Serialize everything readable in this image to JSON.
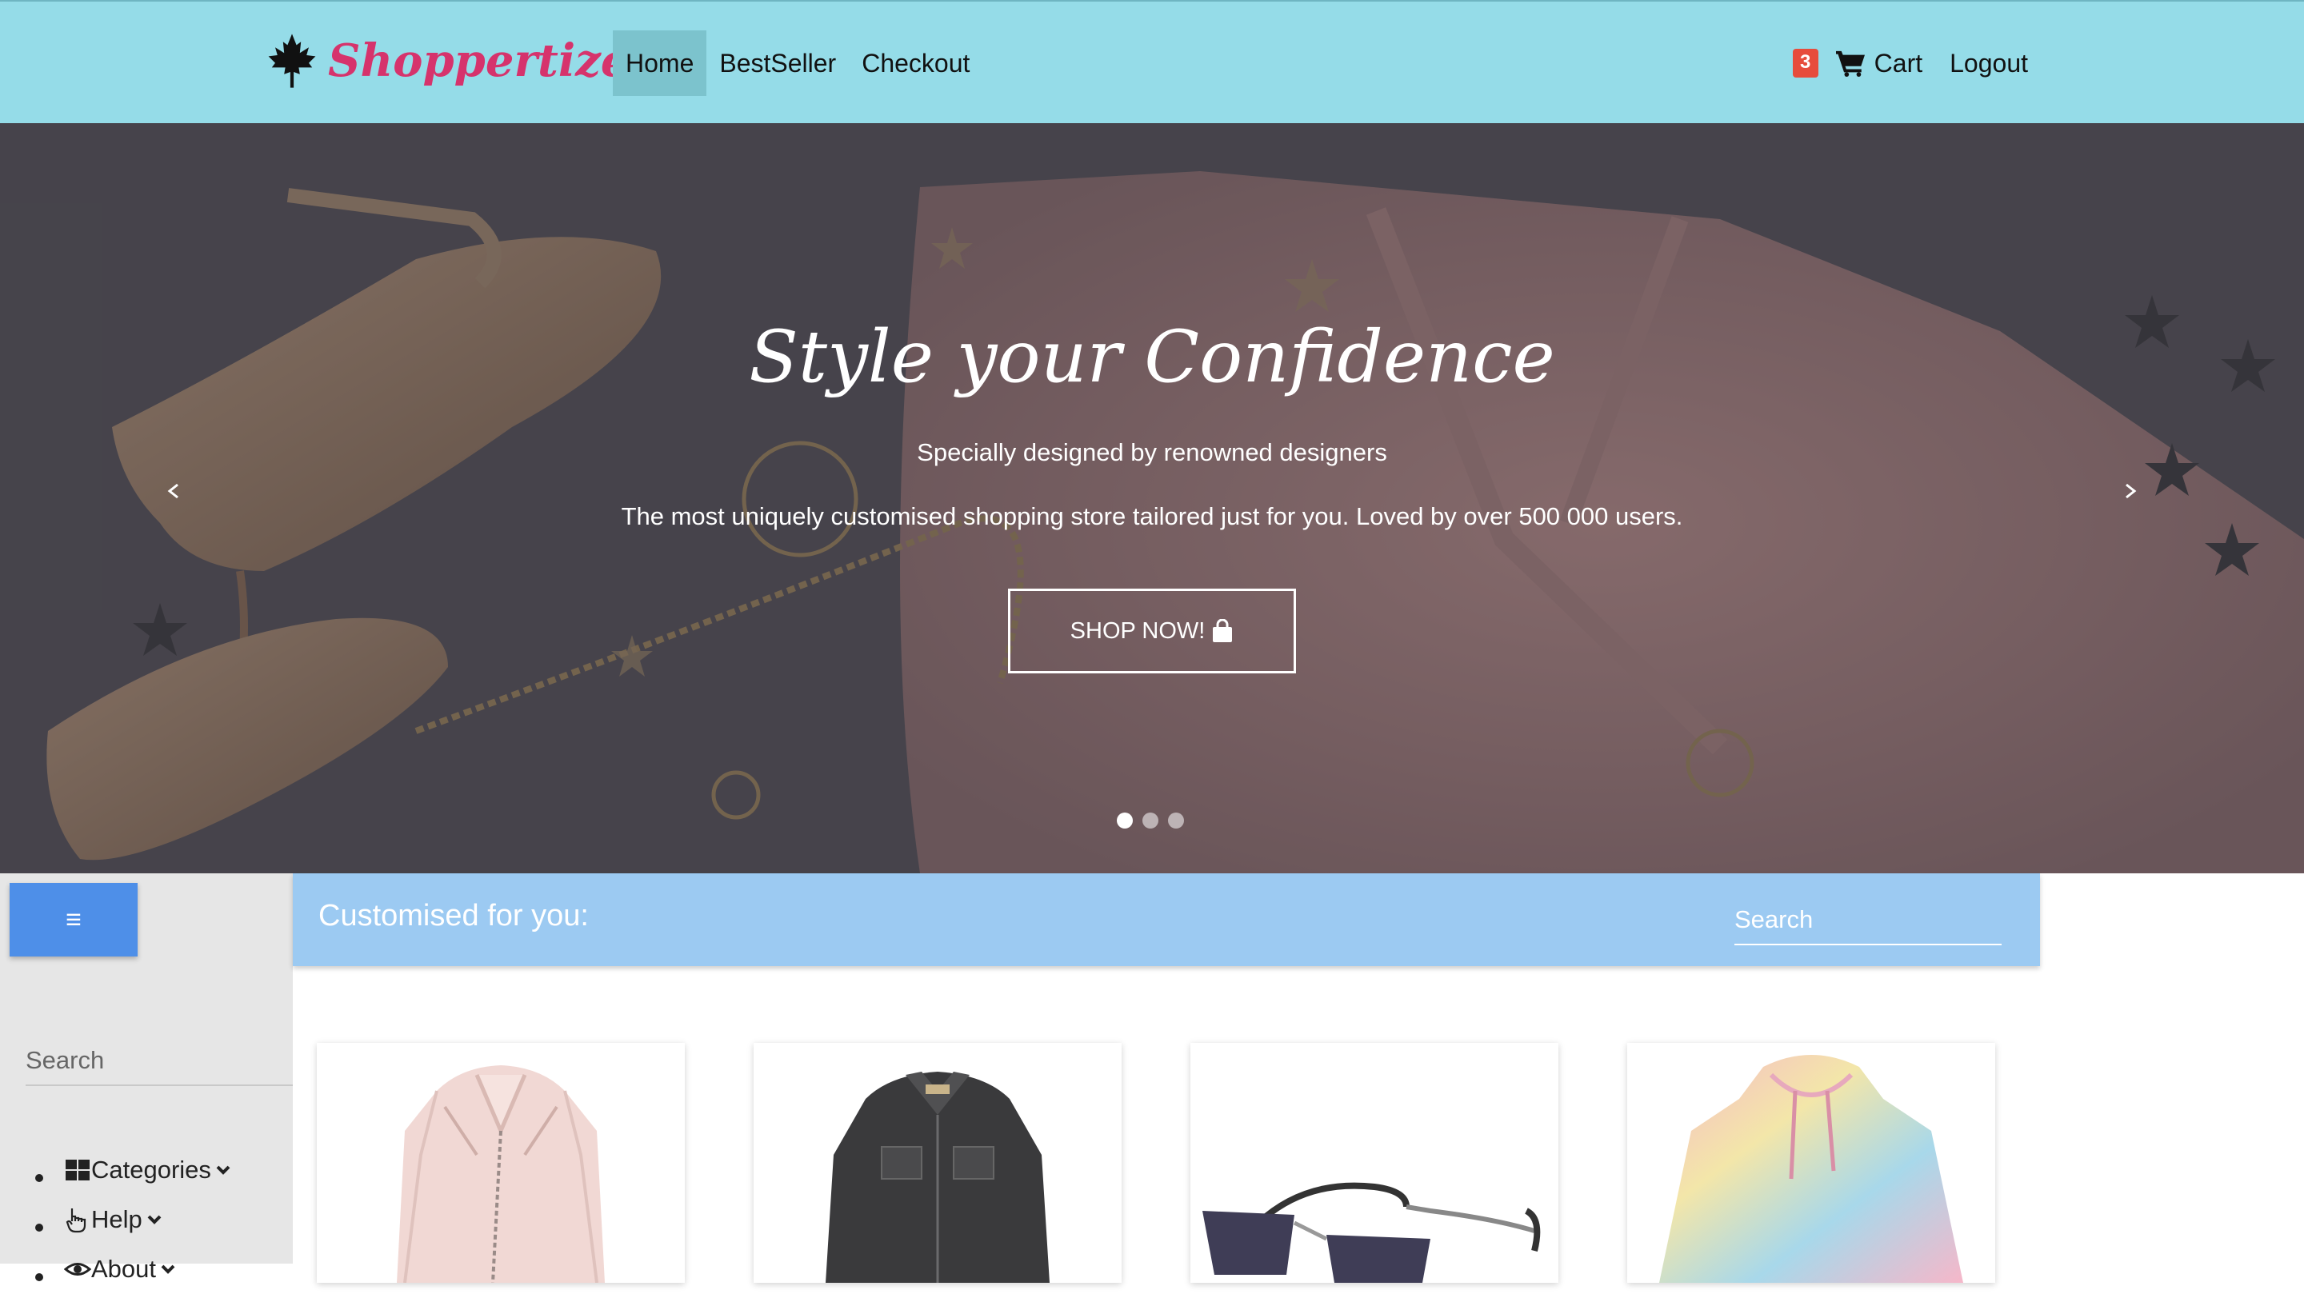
{
  "navbar": {
    "brand": "Shoppertize",
    "links": [
      "Home",
      "BestSeller",
      "Checkout"
    ],
    "active_link": "Home",
    "cart_count": "3",
    "cart_label": "Cart",
    "logout_label": "Logout",
    "icons": {
      "logo": "maple-leaf-icon",
      "cart": "shopping-cart-icon"
    }
  },
  "hero": {
    "title": "Style your Confidence",
    "subtitle": "Specially designed by renowned designers",
    "description": "The most uniquely customised shopping store tailored just for you. Loved by over 500 000 users.",
    "cta_label": "SHOP NOW!",
    "cta_icon": "shopping-bag-icon",
    "slides_count": 3,
    "active_slide": 1
  },
  "sidebar": {
    "menu_icon": "hamburger-icon",
    "search_placeholder": "Search",
    "items": [
      {
        "label": "Categories",
        "icon": "grid-icon"
      },
      {
        "label": "Help",
        "icon": "hand-pointer-icon"
      },
      {
        "label": "About",
        "icon": "eye-icon"
      }
    ]
  },
  "main": {
    "title": "Customised for you:",
    "search_placeholder": "Search",
    "products": [
      {
        "name": "pink-leather-jacket"
      },
      {
        "name": "black-denim-jacket"
      },
      {
        "name": "rimless-sunglasses"
      },
      {
        "name": "tie-dye-hoodie"
      }
    ]
  },
  "colors": {
    "navbar": "#95dce8",
    "brand": "#d6336c",
    "badge": "#e74c3c",
    "menu_button": "#4e8fe8",
    "section_header": "#9ccaf2",
    "sidebar": "#e6e6e6"
  }
}
